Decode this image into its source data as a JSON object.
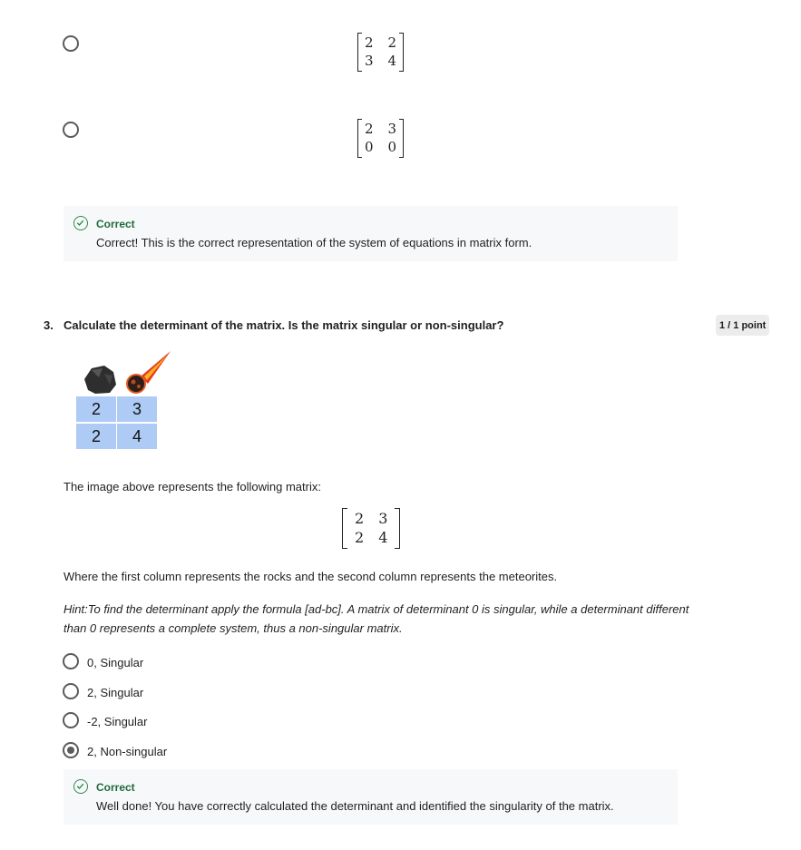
{
  "q2": {
    "options": [
      {
        "matrix": [
          [
            "2",
            "2"
          ],
          [
            "3",
            "4"
          ]
        ],
        "selected": false
      },
      {
        "matrix": [
          [
            "2",
            "3"
          ],
          [
            "0",
            "0"
          ]
        ],
        "selected": false
      }
    ],
    "feedback": {
      "title": "Correct",
      "text": "Correct! This is the correct representation of the system of equations in matrix form."
    }
  },
  "q3": {
    "number": "3.",
    "title": "Calculate the determinant of the matrix. Is the matrix singular or non-singular?",
    "points": "1 / 1 point",
    "image": {
      "cells": [
        [
          "2",
          "3"
        ],
        [
          "2",
          "4"
        ]
      ],
      "icons": [
        "rock-icon",
        "meteorite-icon"
      ]
    },
    "intro": "The image above represents the following matrix:",
    "matrix": [
      [
        "2",
        "3"
      ],
      [
        "2",
        "4"
      ]
    ],
    "column_explanation": "Where the first column represents the rocks and the second column represents the meteorites.",
    "hint": "Hint:To find the determinant apply the formula [ad-bc]. A matrix of determinant 0 is singular, while a determinant different than 0 represents a complete system, thus a non-singular matrix.",
    "options": [
      {
        "label": "0, Singular",
        "selected": false
      },
      {
        "label": "2, Singular",
        "selected": false
      },
      {
        "label": "-2, Singular",
        "selected": false
      },
      {
        "label": "2, Non-singular",
        "selected": true
      }
    ],
    "feedback": {
      "title": "Correct",
      "text": "Well done! You have correctly calculated the determinant and identified the singularity of the matrix."
    }
  },
  "colors": {
    "accent_green": "#1f6b3a",
    "cell_blue": "#aecbf5",
    "feedback_bg": "#f7f8fa"
  }
}
